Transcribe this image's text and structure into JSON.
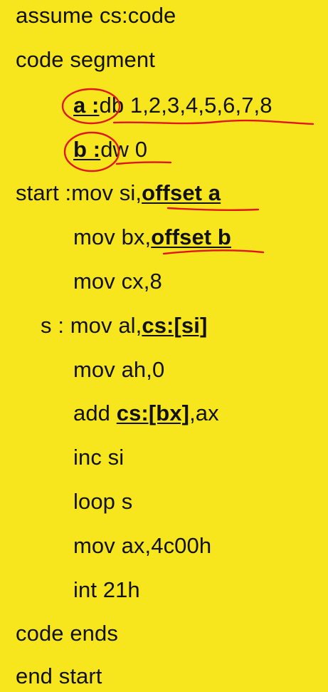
{
  "code": {
    "line1": "assume cs:code",
    "line2": "code segment",
    "line3": {
      "label": "a :",
      "text": "db 1,2,3,4,5,6,7,8"
    },
    "line4": {
      "label": "b :",
      "text": "dw 0"
    },
    "line5": {
      "prefix": "start :mov si,",
      "bold": "offset a"
    },
    "line6": {
      "prefix": "mov bx,",
      "bold": "offset b"
    },
    "line7": "mov cx,8",
    "line8": {
      "prefix": "s : mov al,",
      "bold": "cs:[si]"
    },
    "line9": "mov ah,0",
    "line10": {
      "prefix": "add ",
      "bold": "cs:[bx]",
      "suffix": ",ax"
    },
    "line11": "inc si",
    "line12": "loop s",
    "line13": "mov ax,4c00h",
    "line14": "int 21h",
    "line15": "code ends",
    "line16": "end start"
  },
  "colors": {
    "background": "#f7e61d",
    "text": "#111111",
    "annotation": "#e0161e"
  }
}
